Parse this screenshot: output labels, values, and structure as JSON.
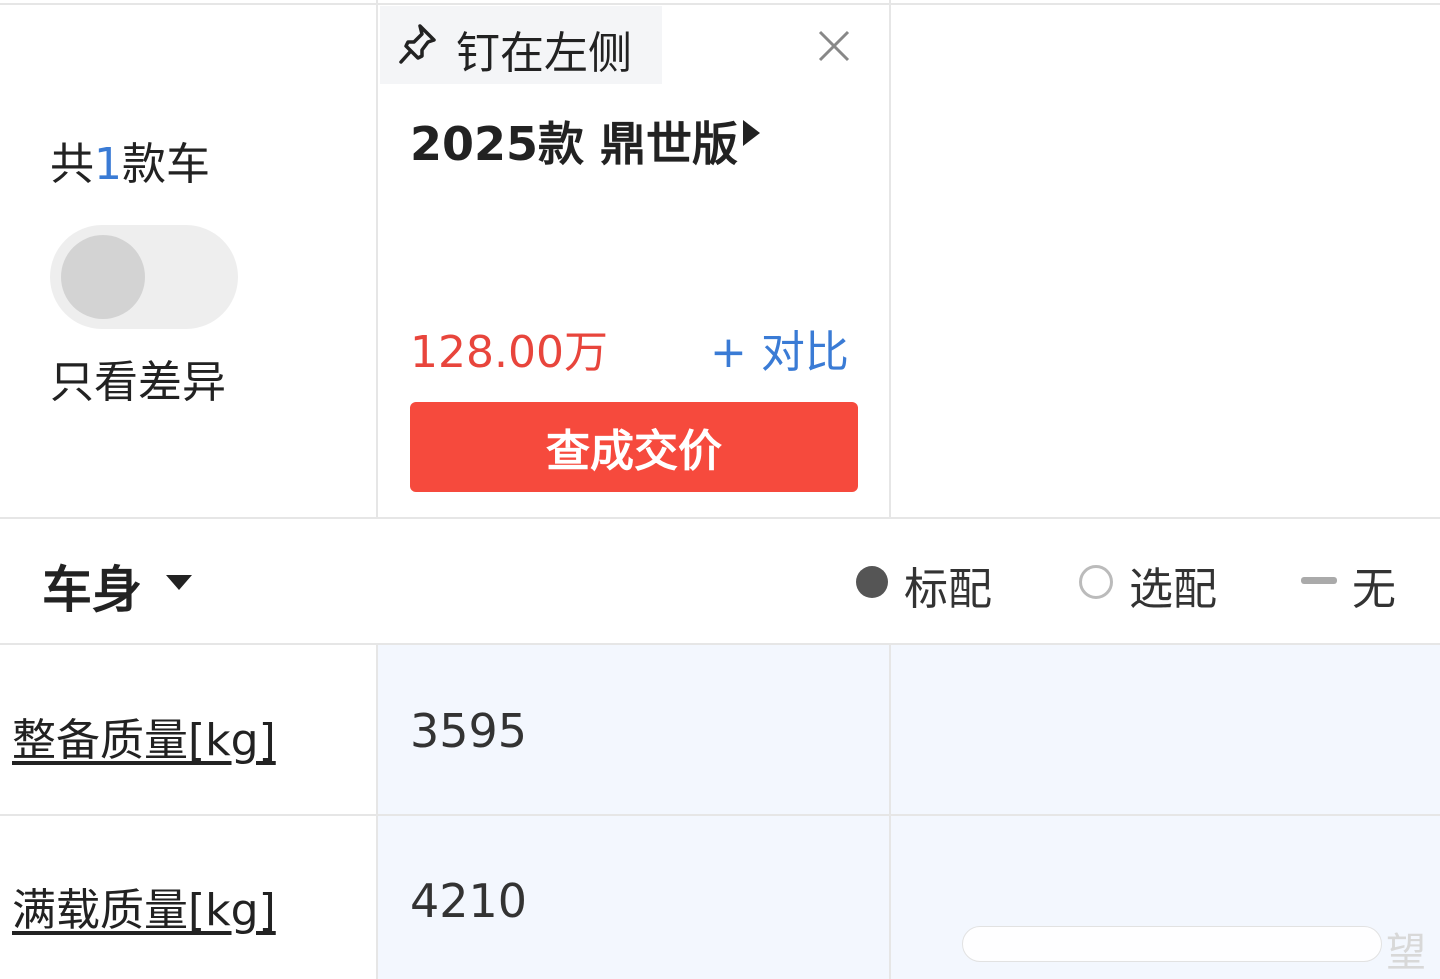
{
  "header": {
    "count_prefix": "共",
    "count_number": "1",
    "count_suffix": "款车",
    "only_diff_label": "只看差异",
    "only_diff_enabled": false
  },
  "car_card": {
    "pin_label": "钉在左侧",
    "name": "2025款 鼎世版",
    "price": "128.00万",
    "compare_label": "+ 对比",
    "deal_price_button": "查成交价"
  },
  "section": {
    "title": "车身",
    "legend": {
      "standard": "标配",
      "optional": "选配",
      "none": "无"
    }
  },
  "rows": [
    {
      "label": "整备质量[kg]",
      "value": "3595"
    },
    {
      "label": "满载质量[kg]",
      "value": "4210"
    }
  ],
  "watermark": {
    "text": "望"
  },
  "colors": {
    "accent_blue": "#3a7bd5",
    "price_red": "#e8453c",
    "button_red": "#f64a3d",
    "row_highlight": "#f3f7fe"
  },
  "icons": [
    "pin-icon",
    "close-icon",
    "caret-right-icon",
    "caret-down-icon",
    "standard-dot-icon",
    "optional-circle-icon",
    "none-dash-icon"
  ]
}
